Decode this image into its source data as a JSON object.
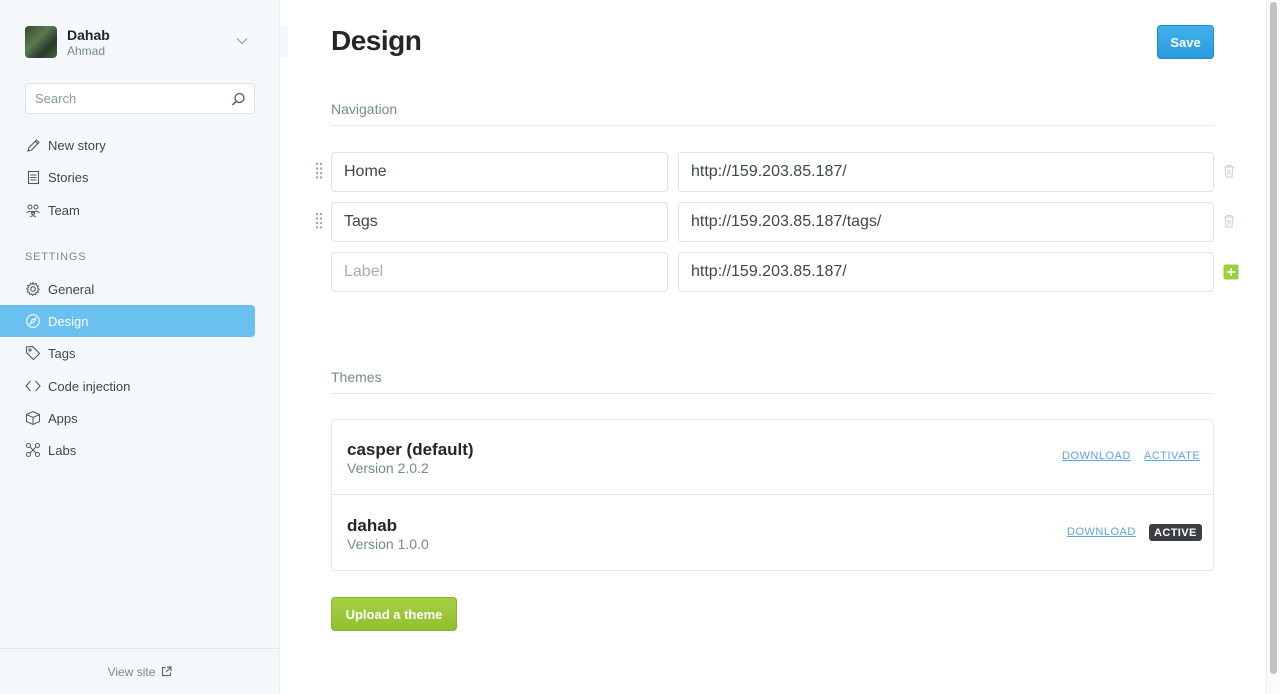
{
  "blog": {
    "title": "Dahab",
    "user": "Ahmad"
  },
  "search": {
    "placeholder": "Search"
  },
  "nav": {
    "new_story": "New story",
    "stories": "Stories",
    "team": "Team",
    "settings_heading": "SETTINGS",
    "general": "General",
    "design": "Design",
    "tags": "Tags",
    "code_injection": "Code injection",
    "apps": "Apps",
    "labs": "Labs",
    "active_item": "Design"
  },
  "footer": {
    "view_site": "View site"
  },
  "page": {
    "title": "Design",
    "save_label": "Save"
  },
  "navigation": {
    "heading": "Navigation",
    "items": [
      {
        "label": "Home",
        "url": "http://159.203.85.187/"
      },
      {
        "label": "Tags",
        "url": "http://159.203.85.187/tags/"
      }
    ],
    "new_item": {
      "label_placeholder": "Label",
      "url": "http://159.203.85.187/"
    }
  },
  "themes": {
    "heading": "Themes",
    "list": [
      {
        "name": "casper (default)",
        "version": "Version 2.0.2",
        "download": "DOWNLOAD",
        "action": "ACTIVATE"
      },
      {
        "name": "dahab",
        "version": "Version 1.0.0",
        "download": "DOWNLOAD",
        "status": "ACTIVE"
      }
    ],
    "upload_label": "Upload a theme"
  },
  "colors": {
    "accent_blue": "#6ac0ef",
    "save_blue": "#2a9be0",
    "upload_green": "#90c030",
    "add_green": "#9fce3c",
    "active_badge": "#3c3f42"
  }
}
